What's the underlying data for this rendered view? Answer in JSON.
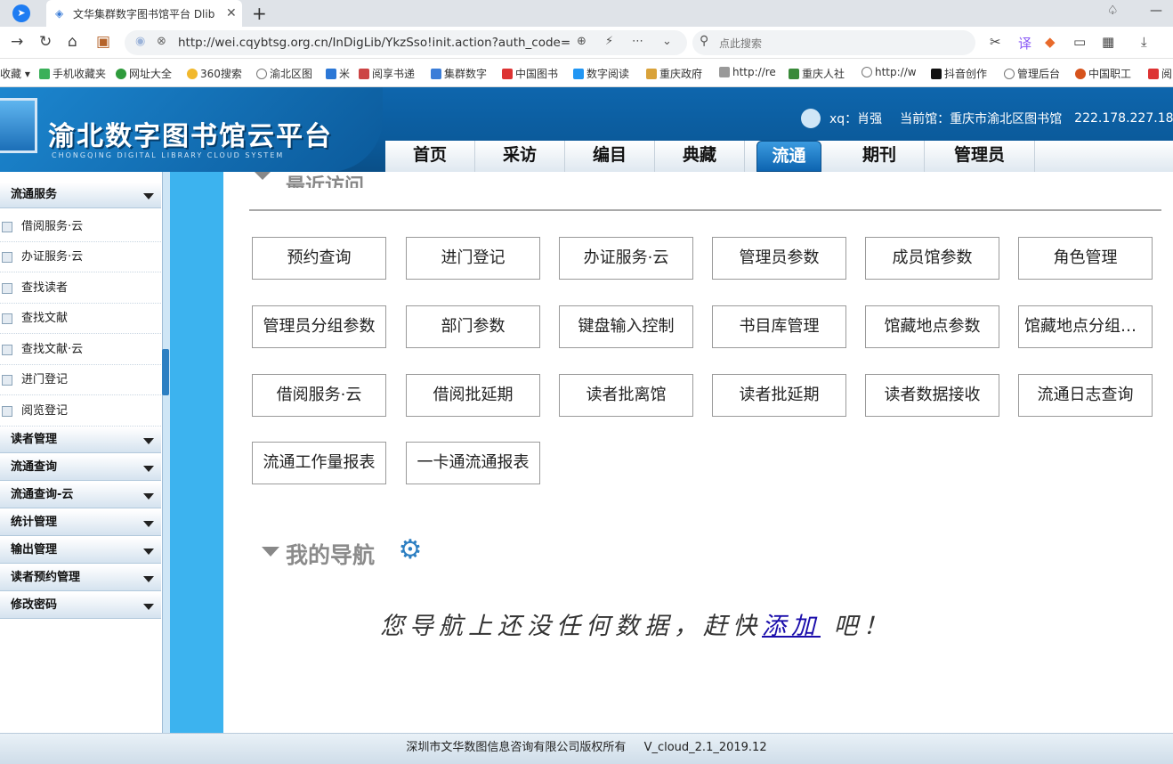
{
  "browser": {
    "tab_title": "文华集群数字图书馆平台 Dlib",
    "url": "http://wei.cqybtsg.org.cn/InDigLib/YkzSso!init.action?auth_code=",
    "search_placeholder": "点此搜索",
    "bookmarks": [
      "收藏",
      "手机收藏夹",
      "网址大全",
      "360搜索",
      "渝北区图",
      "米",
      "阅享书递",
      "集群数字",
      "中国图书",
      "数字阅读",
      "重庆政府",
      "http://re",
      "重庆人社",
      "http://w",
      "抖音创作",
      "管理后台",
      "中国职工",
      "阅"
    ]
  },
  "header": {
    "logo_title": "渝北数字图书馆云平台",
    "logo_subtitle": "CHONGQING DIGITAL LIBRARY CLOUD SYSTEM",
    "user": "xq：肖强",
    "current_library": "当前馆：重庆市渝北区图书馆",
    "ip": "222.178.227.18",
    "menu": [
      "首页",
      "采访",
      "编目",
      "典藏",
      "流通",
      "期刊",
      "管理员"
    ],
    "active_menu": "流通"
  },
  "sidebar": {
    "open_section": "流通服务",
    "open_items": [
      "借阅服务·云",
      "办证服务·云",
      "查找读者",
      "查找文献",
      "查找文献·云",
      "进门登记",
      "阅览登记"
    ],
    "sections": [
      "读者管理",
      "流通查询",
      "流通查询-云",
      "统计管理",
      "输出管理",
      "读者预约管理",
      "修改密码"
    ]
  },
  "main": {
    "recent_title": "最近访问",
    "quick_buttons": [
      "预约查询",
      "进门登记",
      "办证服务·云",
      "管理员参数",
      "成员馆参数",
      "角色管理",
      "管理员分组参数",
      "部门参数",
      "键盘输入控制",
      "书目库管理",
      "馆藏地点参数",
      "馆藏地点分组参数",
      "借阅服务·云",
      "借阅批延期",
      "读者批离馆",
      "读者批延期",
      "读者数据接收",
      "流通日志查询",
      "流通工作量报表",
      "一卡通流通报表"
    ],
    "nav_title": "我的导航",
    "empty_prefix": "您导航上还没任何数据，赶快",
    "empty_link": "添加",
    "empty_suffix": "吧！"
  },
  "footer": {
    "copyright": "深圳市文华数图信息咨询有限公司版权所有",
    "version": "V_cloud_2.1_2019.12"
  }
}
